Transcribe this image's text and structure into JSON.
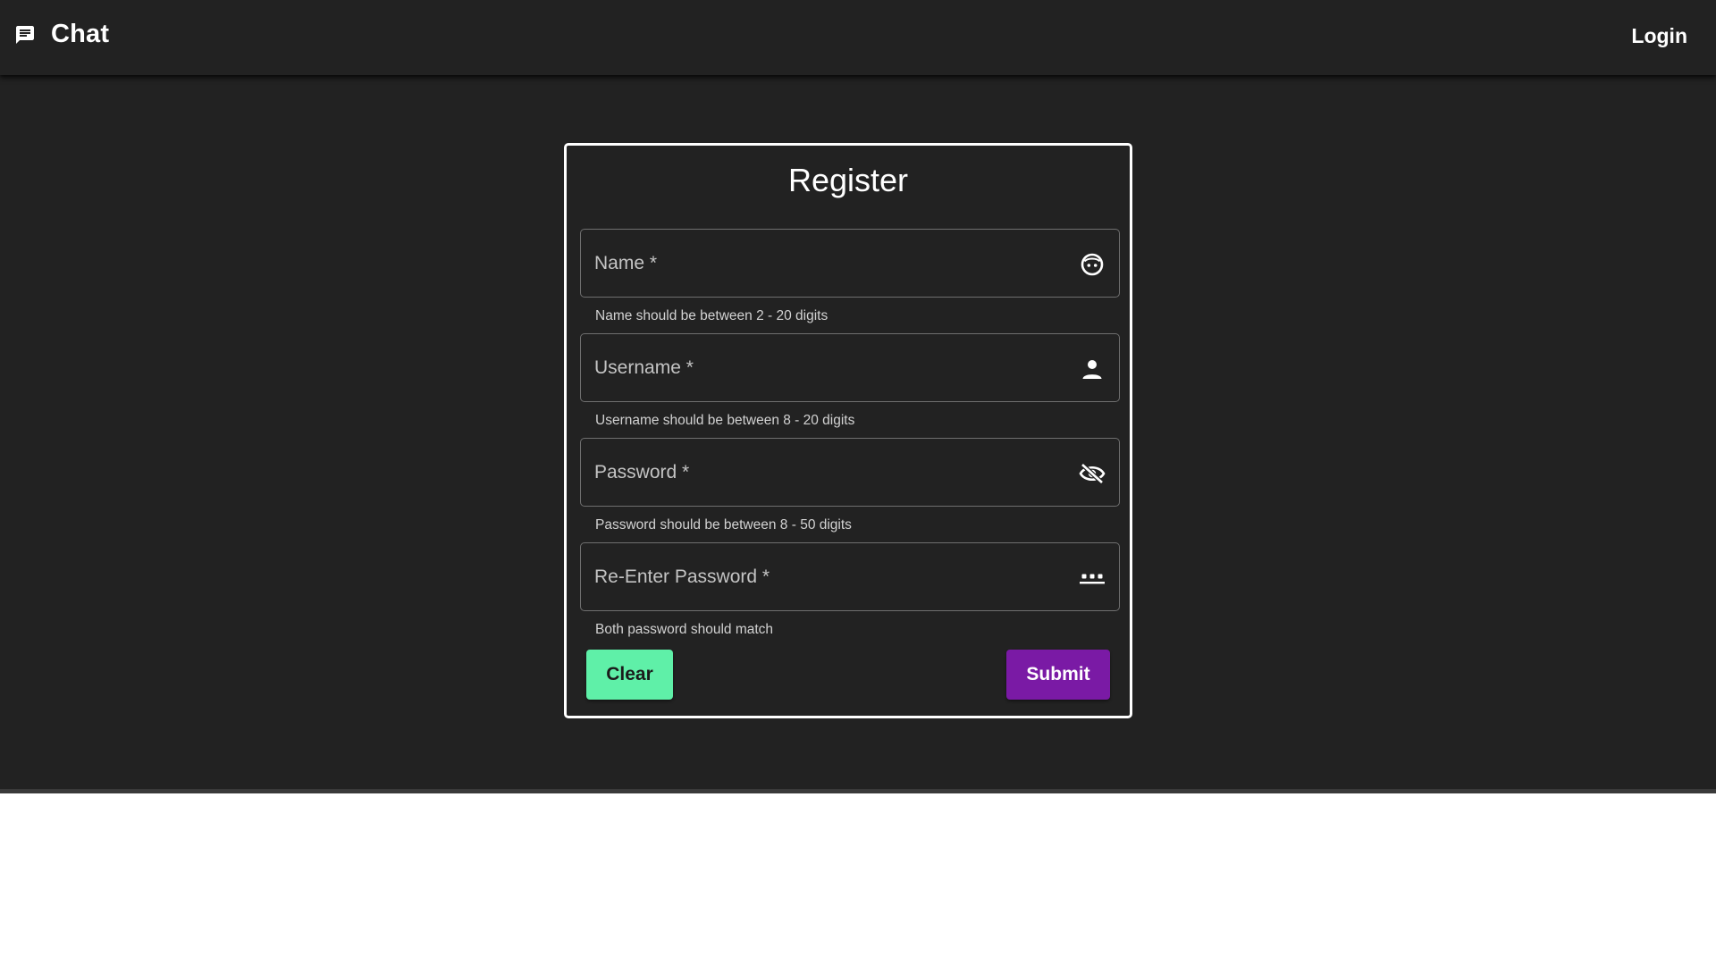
{
  "navbar": {
    "app_title": "Chat",
    "brand_icon": "chat-bubble-icon",
    "login_label": "Login"
  },
  "register": {
    "title": "Register",
    "fields": [
      {
        "label": "Name *",
        "value": "",
        "icon": "face-icon",
        "helper": "Name should be between 2 - 20 digits"
      },
      {
        "label": "Username *",
        "value": "",
        "icon": "person-icon",
        "helper": "Username should be between 8 - 20 digits"
      },
      {
        "label": "Password *",
        "value": "",
        "icon": "eye-off-icon",
        "helper": "Password should be between 8 - 50 digits"
      },
      {
        "label": "Re-Enter Password *",
        "value": "",
        "icon": "password-dots-icon",
        "helper": "Both password should match"
      }
    ],
    "clear_label": "Clear",
    "submit_label": "Submit"
  },
  "colors": {
    "background": "#222222",
    "card_border": "#ffffff",
    "clear_button": "#5ff0a8",
    "submit_button": "#7a1aa5"
  }
}
